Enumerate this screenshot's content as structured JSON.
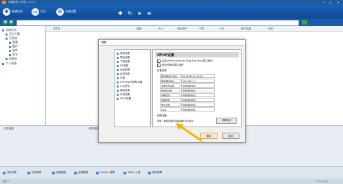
{
  "titlebar": {
    "title": "迅雷看看 正式版 1.0.0.0",
    "minimize": "—",
    "maximize": "□",
    "close": "✕"
  },
  "toolbar": {
    "new_task": "新建任务",
    "open": "打开",
    "settings": "系统设置"
  },
  "sidebar": {
    "items": [
      "全部任务",
      "正在下载",
      "已完成",
      "视频",
      "图片",
      "软件",
      "其它",
      "回收站",
      "个人离线"
    ]
  },
  "columns": [
    "文件名",
    "进度",
    "大小",
    "剩余时间",
    "下载",
    "上传",
    "用户/连接",
    "状态"
  ],
  "lower": {
    "left_header": "文件信息",
    "right_header": "任务详情"
  },
  "bottombar": [
    "任务列表",
    "任务管理",
    "速度限制",
    "资源管理",
    "Tracker 管理",
    "eMule 工具",
    "插件管理"
  ],
  "status": {
    "left": "速度: 0",
    "right": "Tracker 状态"
  },
  "dialog": {
    "title": "设置",
    "close": "✕",
    "tree": [
      "常规设置",
      "界面设置",
      "下载设置",
      "BT设置",
      "连接设置",
      "监视设置",
      "代理",
      "UPnP(NAT穿透)设置",
      "计划任务",
      "高级设置",
      "外观设置",
      "UPnP设置"
    ],
    "panel_title": "UPnP设置",
    "checkbox1": "启用UPnP(Universal Plug and Play)端口映射",
    "checkbox2": "退出时删除端口映射",
    "section": "设备信息",
    "grid": [
      {
        "label": "路由器MAC地址",
        "value": "00-0F-BF-00-00-00"
      },
      {
        "label": "路由器IP地址",
        "value": "192.168.1.1"
      },
      {
        "label": "设备型号名称",
        "value": "没有找到信息"
      },
      {
        "label": "制造商名称",
        "value": "没有找到信息"
      },
      {
        "label": "设备描述",
        "value": "没有找到信息"
      },
      {
        "label": "设备型号",
        "value": "没有找到信息"
      },
      {
        "label": "型号名称",
        "value": "没有找到信息"
      },
      {
        "label": "UDN",
        "value": "没有找到信息"
      }
    ],
    "subsection": "刷新设备",
    "hint": "说明：刷新重新检测路由器UPnP状态",
    "reset": "重新检测",
    "ok": "确定",
    "cancel": "取消"
  },
  "colors": {
    "accent": "#1d5aa0",
    "highlight": "#f2b400"
  }
}
